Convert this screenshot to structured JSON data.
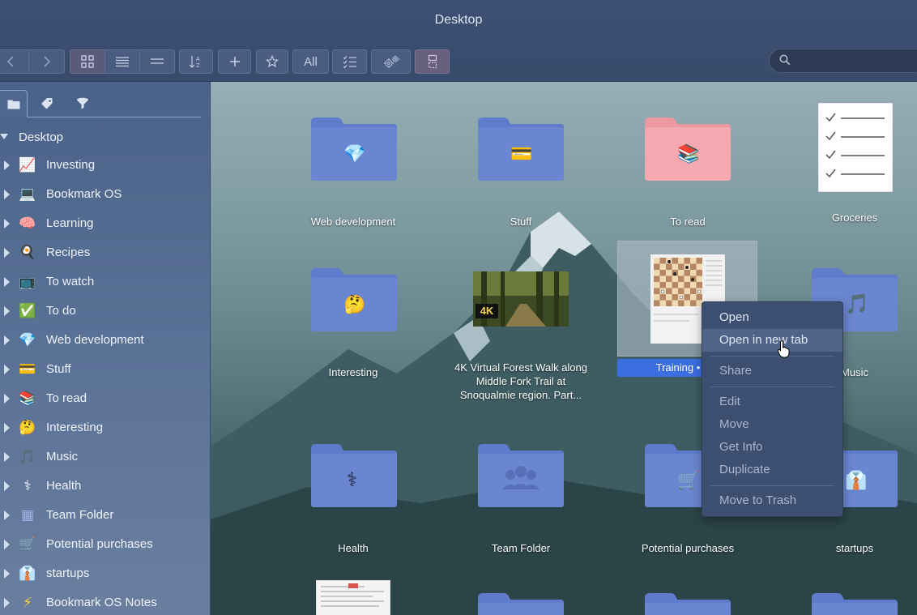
{
  "window": {
    "title": "Desktop"
  },
  "toolbar": {
    "back_icon": "chevron-left",
    "forward_icon": "chevron-right",
    "all_label": "All",
    "search_placeholder": ""
  },
  "sidebar": {
    "tabs": [
      "folder-icon",
      "tag-icon",
      "filter-icon"
    ],
    "root": "Desktop",
    "items": [
      {
        "label": "Investing",
        "emoji": "📈"
      },
      {
        "label": "Bookmark OS",
        "emoji": "💻"
      },
      {
        "label": "Learning",
        "emoji": "🧠"
      },
      {
        "label": "Recipes",
        "emoji": "🍳"
      },
      {
        "label": "To watch",
        "emoji": "📺"
      },
      {
        "label": "To do",
        "emoji": "✅"
      },
      {
        "label": "Web development",
        "emoji": "💎"
      },
      {
        "label": "Stuff",
        "emoji": "💳"
      },
      {
        "label": "To read",
        "emoji": "📚"
      },
      {
        "label": "Interesting",
        "emoji": "🤔"
      },
      {
        "label": "Music",
        "emoji": "🎵"
      },
      {
        "label": "Health",
        "emoji": "⚕"
      },
      {
        "label": "Team Folder",
        "emoji": "▦"
      },
      {
        "label": "Potential purchases",
        "emoji": "🛒"
      },
      {
        "label": "startups",
        "emoji": "👔"
      },
      {
        "label": "Bookmark OS Notes",
        "emoji": "⚡"
      }
    ]
  },
  "main": {
    "tiles": [
      {
        "label": "Web development",
        "icon": "💎"
      },
      {
        "label": "Stuff",
        "icon": "💳"
      },
      {
        "label": "To read",
        "icon": "📚"
      },
      {
        "label": "Groceries"
      },
      {
        "label": "Interesting",
        "icon": "🤔"
      },
      {
        "label": "4K Virtual Forest Walk along Middle Fork Trail at Snoqualmie region. Part..."
      },
      {
        "label": "Training • lich"
      },
      {
        "label": "Music",
        "icon": "🎵"
      },
      {
        "label": "Health",
        "icon": "⚕"
      },
      {
        "label": "Team Folder"
      },
      {
        "label": "Potential purchases",
        "icon": "🛒"
      },
      {
        "label": "startups",
        "icon": "👔"
      }
    ],
    "video_badge": "4K"
  },
  "context_menu": {
    "items": [
      "Open",
      "Open in new tab",
      "Share",
      "Edit",
      "Move",
      "Get Info",
      "Duplicate",
      "Move to Trash"
    ],
    "highlighted": "Open in new tab"
  },
  "colors": {
    "folder_blue": "#6a86d0",
    "folder_pink": "#f4a9b0",
    "selection_blue": "#3b6ee0",
    "menu_bg": "#3c4f71"
  }
}
